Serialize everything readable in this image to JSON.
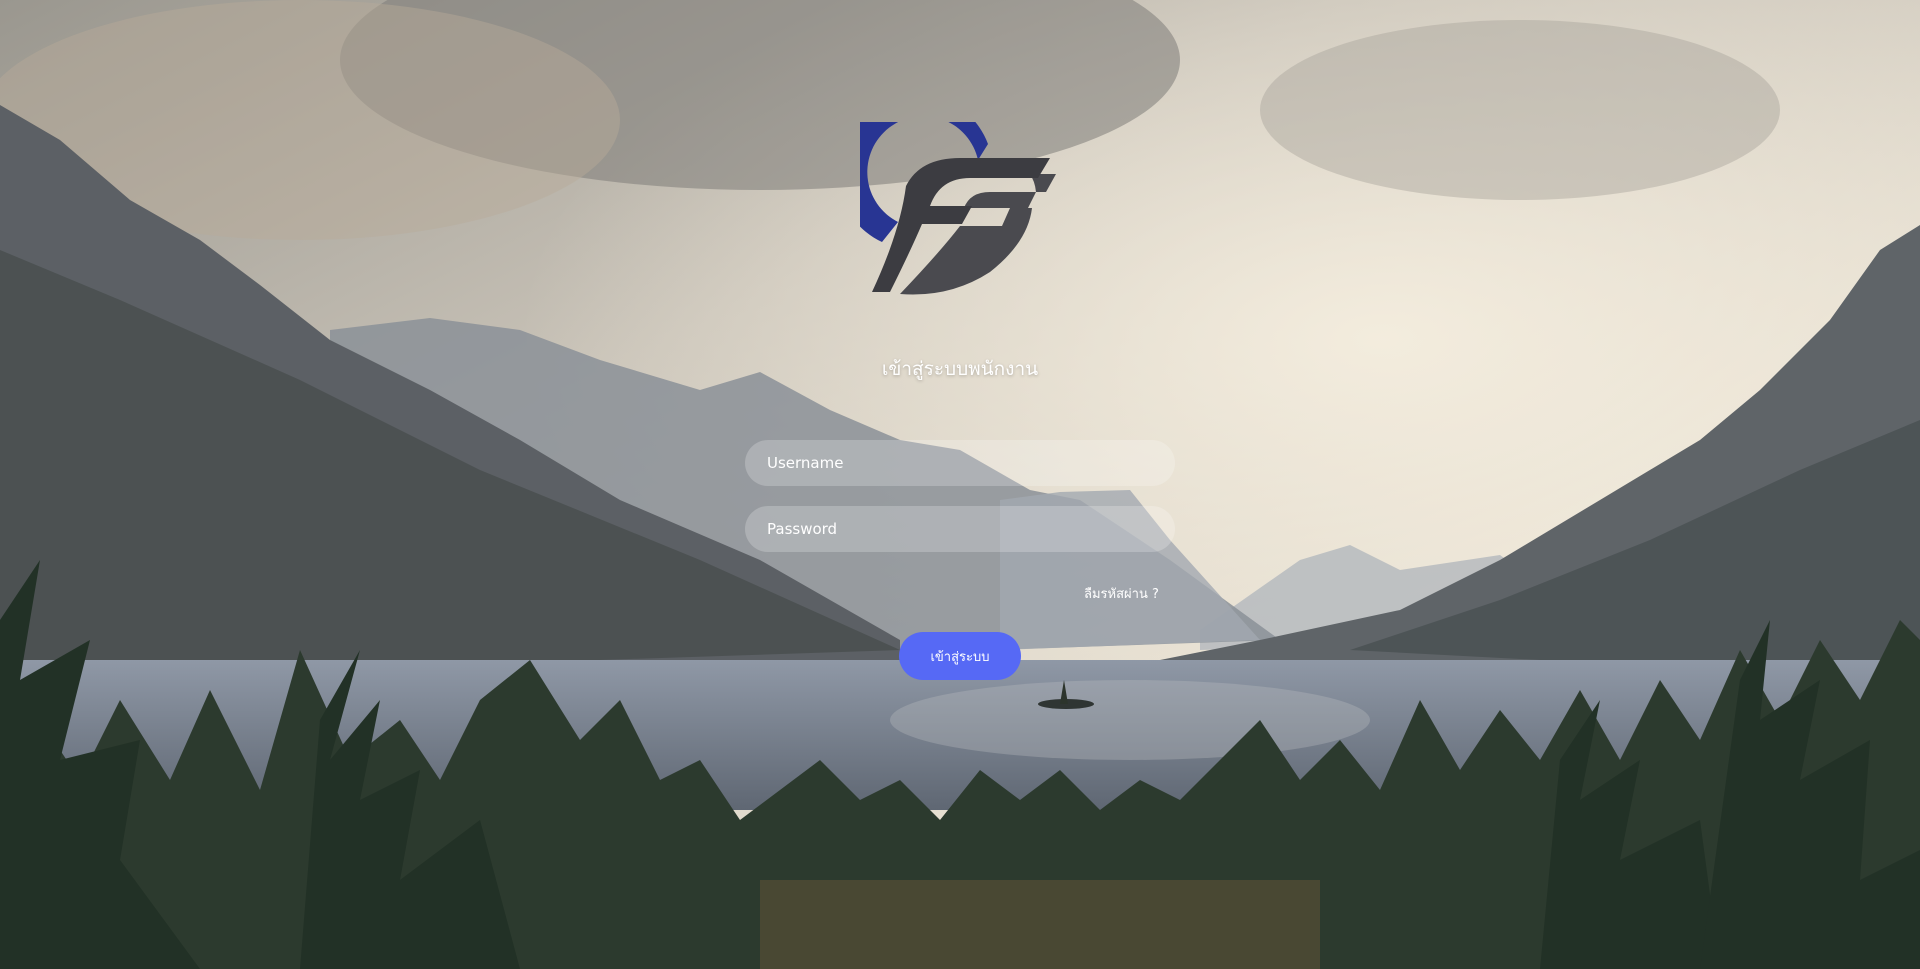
{
  "page": {
    "title": "เข้าสู่ระบบพนักงาน"
  },
  "logo": {
    "icon": "letter-f-logo",
    "colors": {
      "arc": "#283593",
      "body": "#4a4a4f"
    }
  },
  "form": {
    "username": {
      "placeholder": "Username",
      "value": ""
    },
    "password": {
      "placeholder": "Password",
      "value": ""
    },
    "forgot_link": "ลืมรหัสผ่าน ?",
    "submit_label": "เข้าสู่ระบบ"
  },
  "theme": {
    "accent": "#5669f5",
    "field_bg": "rgba(255,255,255,0.22)",
    "text": "#ffffff"
  },
  "background": {
    "icon": "mountain-lake-landscape-photo"
  }
}
